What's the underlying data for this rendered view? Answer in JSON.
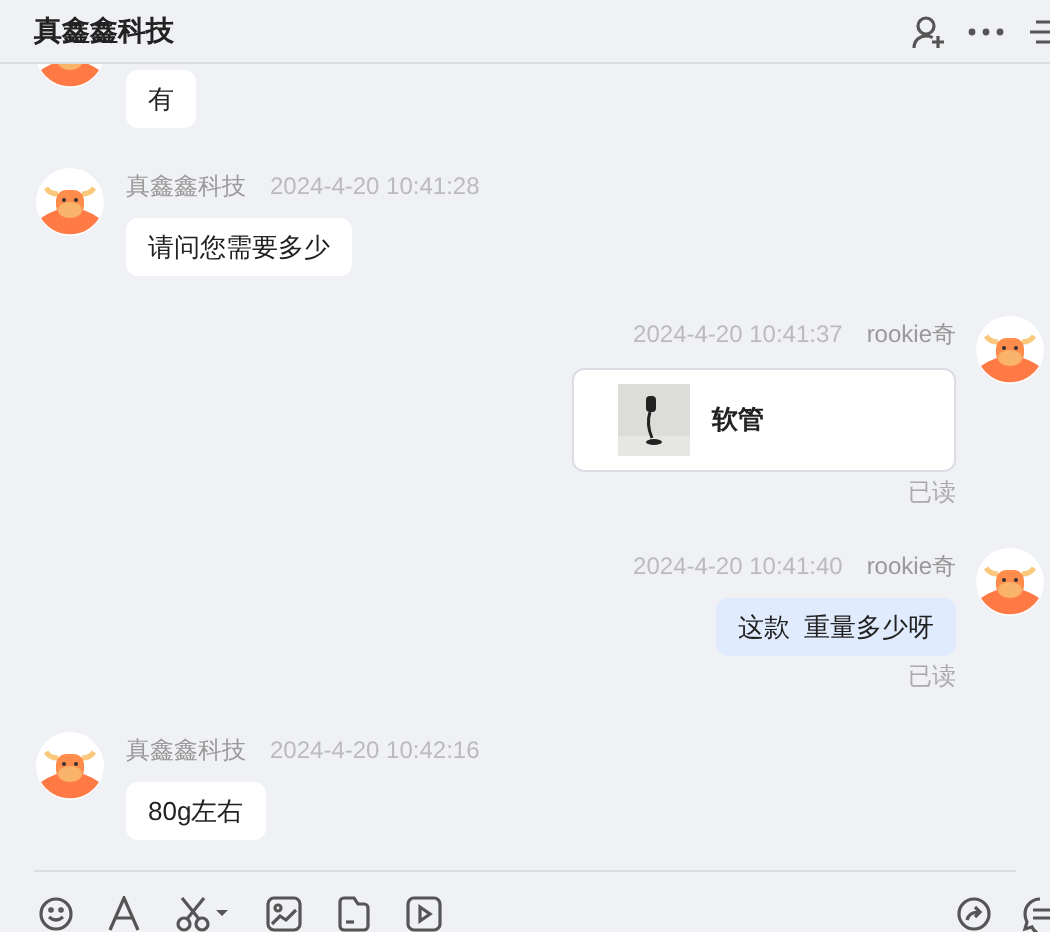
{
  "header": {
    "title": "真鑫鑫科技"
  },
  "messages": [
    {
      "outgoing": false,
      "kind": "text",
      "text": "有"
    },
    {
      "outgoing": false,
      "kind": "text",
      "name": "真鑫鑫科技",
      "time": "2024-4-20 10:41:28",
      "text": "请问您需要多少"
    },
    {
      "outgoing": true,
      "kind": "product",
      "name": "rookie奇",
      "time": "2024-4-20 10:41:37",
      "text": "软管",
      "read": "已读"
    },
    {
      "outgoing": true,
      "kind": "text",
      "name": "rookie奇",
      "time": "2024-4-20 10:41:40",
      "text": "这款  重量多少呀",
      "read": "已读"
    },
    {
      "outgoing": false,
      "kind": "text",
      "name": "真鑫鑫科技",
      "time": "2024-4-20 10:42:16",
      "text": "80g左右"
    }
  ]
}
